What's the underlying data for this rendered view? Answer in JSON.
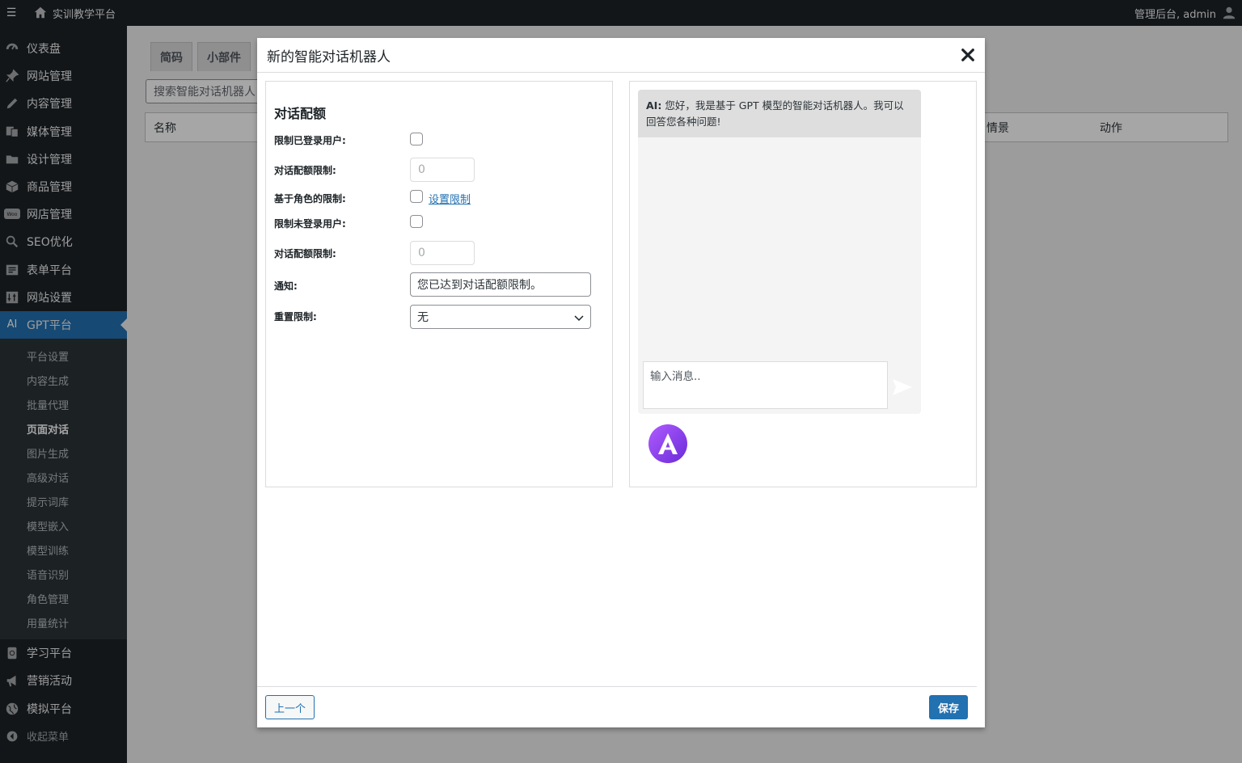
{
  "topbar": {
    "menu_icon": "☰",
    "site_name": "实训教学平台",
    "user_greeting": "管理后台, admin"
  },
  "sidebar": {
    "items": [
      {
        "label": "仪表盘",
        "icon": "dashboard-icon"
      },
      {
        "label": "网站管理",
        "icon": "pin-icon"
      },
      {
        "label": "内容管理",
        "icon": "pencil-icon"
      },
      {
        "label": "媒体管理",
        "icon": "media-icon"
      },
      {
        "label": "设计管理",
        "icon": "folder-icon"
      },
      {
        "label": "商品管理",
        "icon": "box-icon"
      },
      {
        "label": "网店管理",
        "icon": "woo-icon"
      },
      {
        "label": "SEO优化",
        "icon": "search-icon"
      },
      {
        "label": "表单平台",
        "icon": "form-icon"
      },
      {
        "label": "网站设置",
        "icon": "settings-icon"
      },
      {
        "label": "GPT平台",
        "icon": "ai-icon",
        "icon_text": "AI",
        "active": true
      }
    ],
    "submenu": [
      "平台设置",
      "内容生成",
      "批量代理",
      "页面对话",
      "图片生成",
      "高级对话",
      "提示词库",
      "模型嵌入",
      "模型训练",
      "语音识别",
      "角色管理",
      "用量统计"
    ],
    "submenu_current": "页面对话",
    "bottom_items": [
      {
        "label": "学习平台",
        "icon": "learn-icon"
      },
      {
        "label": "营销活动",
        "icon": "megaphone-icon"
      },
      {
        "label": "模拟平台",
        "icon": "globe-icon"
      }
    ],
    "collapse_label": "收起菜单"
  },
  "background": {
    "tabs": [
      "简码",
      "小部件"
    ],
    "search_placeholder": "搜索智能对话机器人",
    "table_headers": [
      "名称",
      "情景",
      "动作"
    ]
  },
  "modal": {
    "title": "新的智能对话机器人",
    "section_title": "对话配额",
    "fields": {
      "limit_logged_in_label": "限制已登录用户:",
      "quota_limit_label_1": "对话配额限制:",
      "quota_limit_value_1": "0",
      "role_limit_label": "基于角色的限制:",
      "role_limit_link": "设置限制",
      "limit_guests_label": "限制未登录用户:",
      "quota_limit_label_2": "对话配额限制:",
      "quota_limit_value_2": "0",
      "notice_label": "通知:",
      "notice_value": "您已达到对话配额限制。",
      "reset_label": "重置限制:",
      "reset_value": "无"
    },
    "chat": {
      "ai_prefix": "AI:",
      "ai_message": "您好，我是基于 GPT 模型的智能对话机器人。我可以回答您各种问题!",
      "input_placeholder": "输入消息..",
      "avatar_letter": "A"
    },
    "buttons": {
      "previous": "上一个",
      "save": "保存"
    }
  },
  "colors": {
    "admin_bar": "#1d2327",
    "accent": "#2271b1",
    "submenu_bg": "#2c3338"
  }
}
